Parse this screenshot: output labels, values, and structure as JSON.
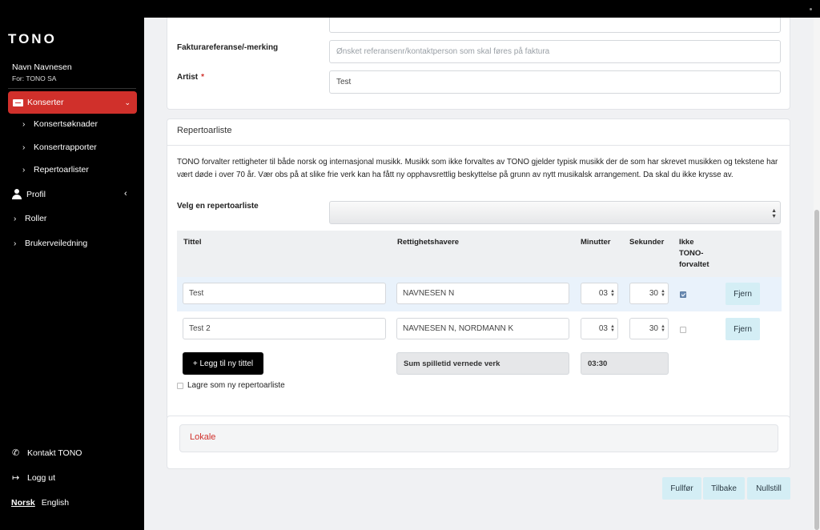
{
  "sidebar": {
    "logo": "TONO",
    "user_name": "Navn Navnesen",
    "user_for": "For: TONO SA",
    "nav": [
      {
        "label": "Konserter"
      },
      {
        "label": "Konsertsøknader"
      },
      {
        "label": "Konsertrapporter"
      },
      {
        "label": "Repertoarlister"
      },
      {
        "label": "Profil"
      },
      {
        "label": "Roller"
      },
      {
        "label": "Brukerveiledning"
      }
    ],
    "contact": "Kontakt TONO",
    "logout": "Logg ut",
    "lang_active": "Norsk",
    "lang_other": "English"
  },
  "form": {
    "faktura_label": "Fakturareferanse/-merking",
    "faktura_placeholder": "Ønsket referansenr/kontaktperson som skal føres på faktura",
    "artist_label": "Artist",
    "artist_required": "*",
    "artist_value": "Test"
  },
  "repertoar": {
    "header": "Repertoarliste",
    "intro": "TONO forvalter rettigheter til både norsk og internasjonal musikk. Musikk som ikke forvaltes av TONO gjelder typisk musikk der de som har skrevet musikken og tekstene har vært døde i over 70 år. Vær obs på at slike frie verk kan ha fått ny opphavsrettlig beskyttelse på grunn av nytt musikalsk arrangement. Da skal du ikke krysse av.",
    "select_label": "Velg en repertoarliste",
    "columns": {
      "title": "Tittel",
      "rights": "Rettighetshavere",
      "minutes": "Minutter",
      "seconds": "Sekunder",
      "not_tono_1": "Ikke",
      "not_tono_2": "TONO-",
      "not_tono_3": "forvaltet"
    },
    "rows": [
      {
        "title": "Test",
        "rights": "NAVNESEN N",
        "minutes": "03",
        "seconds": "30",
        "not_tono": true,
        "remove": "Fjern"
      },
      {
        "title": "Test 2",
        "rights": "NAVNESEN N, NORDMANN K",
        "minutes": "03",
        "seconds": "30",
        "not_tono": false,
        "remove": "Fjern"
      }
    ],
    "add_title": "+ Legg til ny tittel",
    "sum_label": "Sum spilletid vernede verk",
    "sum_value": "03:30",
    "save_as_new": "Lagre som ny repertoarliste"
  },
  "lokale": {
    "label": "Lokale"
  },
  "actions": {
    "finish": "Fullfør",
    "back": "Tilbake",
    "reset": "Nullstill"
  },
  "colors": {
    "accent": "#d0302b",
    "light_button": "#d4eef5",
    "row_highlight": "#e9f2fb"
  }
}
